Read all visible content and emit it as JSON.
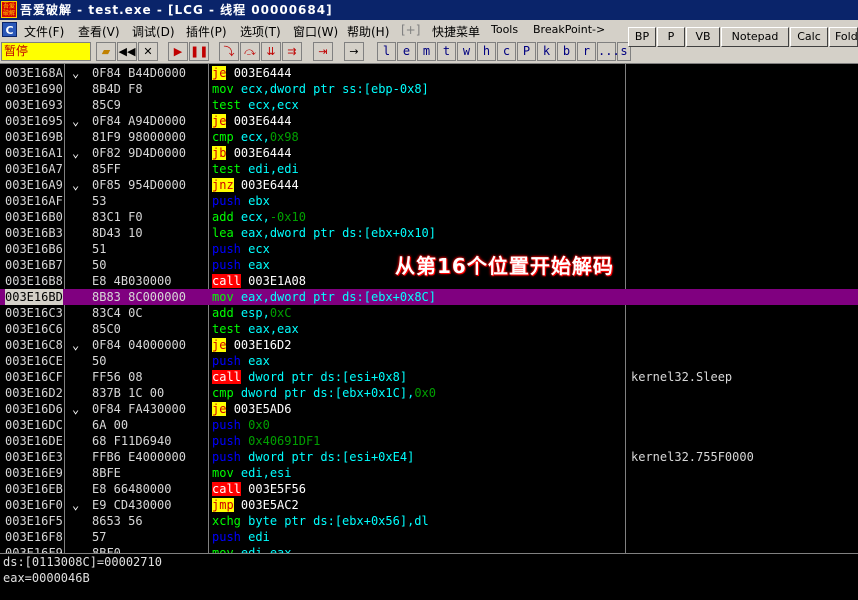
{
  "window": {
    "title": "吾爱破解 - test.exe - [LCG - 线程 00000684]",
    "logo_text": "吾爱破解"
  },
  "menu": {
    "items": [
      "文件(F)",
      "查看(V)",
      "调试(D)",
      "插件(P)",
      "选项(T)",
      "窗口(W)",
      "帮助(H)",
      "[+]",
      "快捷菜单",
      "Tools",
      "BreakPoint->"
    ]
  },
  "toolbar": {
    "status": "暂停",
    "letters": [
      "l",
      "e",
      "m",
      "t",
      "w",
      "h",
      "c",
      "P",
      "k",
      "b",
      "r",
      "...",
      "s"
    ],
    "right_buttons": [
      "BP",
      "P",
      "VB",
      "Notepad",
      "Calc",
      "Fold"
    ]
  },
  "disasm": {
    "rows": [
      {
        "addr": "003E168A",
        "jmp": "⌄",
        "hex": "0F84 B44D0000",
        "kind": "j",
        "mn": "je",
        "ops": [
          {
            "t": "003E6444",
            "c": "w"
          }
        ],
        "comment": ""
      },
      {
        "addr": "003E1690",
        "jmp": "",
        "hex": "8B4D F8",
        "kind": "n",
        "mn": "mov",
        "ops": [
          {
            "t": "ecx,dword ptr ss:[ebp-0x8]",
            "c": "op"
          }
        ],
        "comment": ""
      },
      {
        "addr": "003E1693",
        "jmp": "",
        "hex": "85C9",
        "kind": "n",
        "mn": "test",
        "ops": [
          {
            "t": "ecx,ecx",
            "c": "op"
          }
        ],
        "comment": ""
      },
      {
        "addr": "003E1695",
        "jmp": "⌄",
        "hex": "0F84 A94D0000",
        "kind": "j",
        "mn": "je",
        "ops": [
          {
            "t": "003E6444",
            "c": "w"
          }
        ],
        "comment": ""
      },
      {
        "addr": "003E169B",
        "jmp": "",
        "hex": "81F9 98000000",
        "kind": "n",
        "mn": "cmp",
        "ops": [
          {
            "t": "ecx,",
            "c": "op"
          },
          {
            "t": "0x98",
            "c": "num"
          }
        ],
        "comment": ""
      },
      {
        "addr": "003E16A1",
        "jmp": "⌄",
        "hex": "0F82 9D4D0000",
        "kind": "j",
        "mn": "jb",
        "ops": [
          {
            "t": "003E6444",
            "c": "w"
          }
        ],
        "comment": ""
      },
      {
        "addr": "003E16A7",
        "jmp": "",
        "hex": "85FF",
        "kind": "n",
        "mn": "test",
        "ops": [
          {
            "t": "edi,edi",
            "c": "op"
          }
        ],
        "comment": ""
      },
      {
        "addr": "003E16A9",
        "jmp": "⌄",
        "hex": "0F85 954D0000",
        "kind": "j",
        "mn": "jnz",
        "ops": [
          {
            "t": "003E6444",
            "c": "w"
          }
        ],
        "comment": ""
      },
      {
        "addr": "003E16AF",
        "jmp": "",
        "hex": "53",
        "kind": "p",
        "mn": "push",
        "ops": [
          {
            "t": "ebx",
            "c": "op"
          }
        ],
        "comment": ""
      },
      {
        "addr": "003E16B0",
        "jmp": "",
        "hex": "83C1 F0",
        "kind": "n",
        "mn": "add",
        "ops": [
          {
            "t": "ecx,",
            "c": "op"
          },
          {
            "t": "-0x10",
            "c": "num"
          }
        ],
        "comment": ""
      },
      {
        "addr": "003E16B3",
        "jmp": "",
        "hex": "8D43 10",
        "kind": "n",
        "mn": "lea",
        "ops": [
          {
            "t": "eax,dword ptr ds:[ebx+0x10]",
            "c": "op"
          }
        ],
        "comment": ""
      },
      {
        "addr": "003E16B6",
        "jmp": "",
        "hex": "51",
        "kind": "p",
        "mn": "push",
        "ops": [
          {
            "t": "ecx",
            "c": "op"
          }
        ],
        "comment": ""
      },
      {
        "addr": "003E16B7",
        "jmp": "",
        "hex": "50",
        "kind": "p",
        "mn": "push",
        "ops": [
          {
            "t": "eax",
            "c": "op"
          }
        ],
        "comment": ""
      },
      {
        "addr": "003E16B8",
        "jmp": "",
        "hex": "E8 4B030000",
        "kind": "c",
        "mn": "call",
        "ops": [
          {
            "t": "003E1A08",
            "c": "w"
          }
        ],
        "comment": ""
      },
      {
        "addr": "003E16BD",
        "jmp": "",
        "hex": "8B83 8C000000",
        "kind": "n",
        "mn": "mov",
        "ops": [
          {
            "t": "eax,dword ptr ds:[ebx+0x8C]",
            "c": "op"
          }
        ],
        "comment": "",
        "selected": true
      },
      {
        "addr": "003E16C3",
        "jmp": "",
        "hex": "83C4 0C",
        "kind": "n",
        "mn": "add",
        "ops": [
          {
            "t": "esp,",
            "c": "op"
          },
          {
            "t": "0xC",
            "c": "num"
          }
        ],
        "comment": ""
      },
      {
        "addr": "003E16C6",
        "jmp": "",
        "hex": "85C0",
        "kind": "n",
        "mn": "test",
        "ops": [
          {
            "t": "eax,eax",
            "c": "op"
          }
        ],
        "comment": ""
      },
      {
        "addr": "003E16C8",
        "jmp": "⌄",
        "hex": "0F84 04000000",
        "kind": "j",
        "mn": "je",
        "ops": [
          {
            "t": "003E16D2",
            "c": "w"
          }
        ],
        "comment": ""
      },
      {
        "addr": "003E16CE",
        "jmp": "",
        "hex": "50",
        "kind": "p",
        "mn": "push",
        "ops": [
          {
            "t": "eax",
            "c": "op"
          }
        ],
        "comment": ""
      },
      {
        "addr": "003E16CF",
        "jmp": "",
        "hex": "FF56 08",
        "kind": "c",
        "mn": "call",
        "ops": [
          {
            "t": "dword ptr ds:[esi+0x8]",
            "c": "op"
          }
        ],
        "comment": "kernel32.Sleep"
      },
      {
        "addr": "003E16D2",
        "jmp": "",
        "hex": "837B 1C 00",
        "kind": "n",
        "mn": "cmp",
        "ops": [
          {
            "t": "dword ptr ds:[ebx+0x1C],",
            "c": "op"
          },
          {
            "t": "0x0",
            "c": "num"
          }
        ],
        "comment": ""
      },
      {
        "addr": "003E16D6",
        "jmp": "⌄",
        "hex": "0F84 FA430000",
        "kind": "j",
        "mn": "je",
        "ops": [
          {
            "t": "003E5AD6",
            "c": "w"
          }
        ],
        "comment": ""
      },
      {
        "addr": "003E16DC",
        "jmp": "",
        "hex": "6A 00",
        "kind": "p",
        "mn": "push",
        "ops": [
          {
            "t": "0x0",
            "c": "num"
          }
        ],
        "comment": ""
      },
      {
        "addr": "003E16DE",
        "jmp": "",
        "hex": "68 F11D6940",
        "kind": "p",
        "mn": "push",
        "ops": [
          {
            "t": "0x40691DF1",
            "c": "num"
          }
        ],
        "comment": ""
      },
      {
        "addr": "003E16E3",
        "jmp": "",
        "hex": "FFB6 E4000000",
        "kind": "p",
        "mn": "push",
        "ops": [
          {
            "t": "dword ptr ds:[esi+0xE4]",
            "c": "op"
          }
        ],
        "comment": "kernel32.755F0000"
      },
      {
        "addr": "003E16E9",
        "jmp": "",
        "hex": "8BFE",
        "kind": "n",
        "mn": "mov",
        "ops": [
          {
            "t": "edi,esi",
            "c": "op"
          }
        ],
        "comment": ""
      },
      {
        "addr": "003E16EB",
        "jmp": "",
        "hex": "E8 66480000",
        "kind": "c",
        "mn": "call",
        "ops": [
          {
            "t": "003E5F56",
            "c": "w"
          }
        ],
        "comment": ""
      },
      {
        "addr": "003E16F0",
        "jmp": "⌄",
        "hex": "E9 CD430000",
        "kind": "j",
        "mn": "jmp",
        "ops": [
          {
            "t": "003E5AC2",
            "c": "w"
          }
        ],
        "comment": ""
      },
      {
        "addr": "003E16F5",
        "jmp": "",
        "hex": "8653 56",
        "kind": "n",
        "mn": "xchg",
        "ops": [
          {
            "t": "byte ptr ds:[ebx+0x56],dl",
            "c": "op"
          }
        ],
        "comment": ""
      },
      {
        "addr": "003E16F8",
        "jmp": "",
        "hex": "57",
        "kind": "p",
        "mn": "push",
        "ops": [
          {
            "t": "edi",
            "c": "op"
          }
        ],
        "comment": ""
      },
      {
        "addr": "003E16F9",
        "jmp": "",
        "hex": "8BF0",
        "kind": "n",
        "mn": "mov",
        "ops": [
          {
            "t": "edi,eax",
            "c": "op"
          }
        ],
        "comment": ""
      }
    ]
  },
  "annotation": "从第16个位置开始解码",
  "info": {
    "line1": "ds:[0113008C]=00002710",
    "line2": "eax=0000046B"
  },
  "colors": {
    "selected_row": "#800080",
    "jump_bg": "#ffff00",
    "call_bg": "#ff0000",
    "push": "#0000ff",
    "mnemonic": "#00ff00",
    "operand": "#00ffff"
  }
}
